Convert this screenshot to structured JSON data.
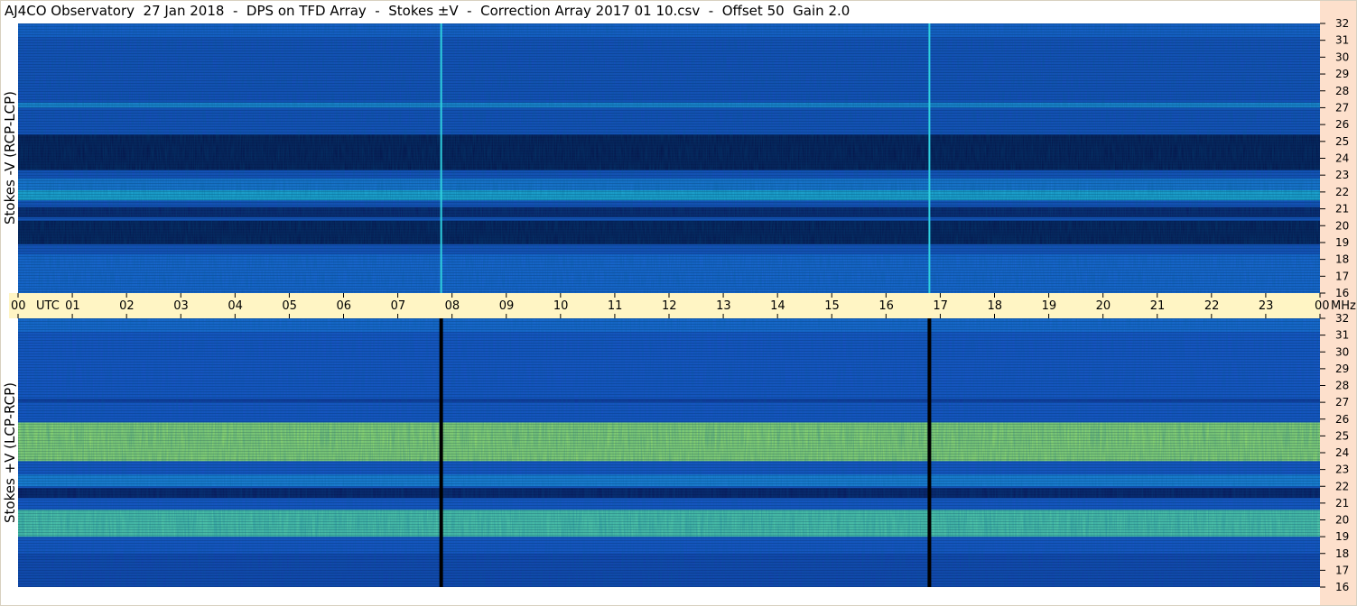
{
  "title": "AJ4CO Observatory  27 Jan 2018  -  DPS on TFD Array  -  Stokes ±V  -  Correction Array 2017 01 10.csv  -  Offset 50  Gain 2.0",
  "colors": {
    "background": "#ffffff",
    "axis_strip": "#fff5c4",
    "freq_strip": "#fde0cc",
    "dark": "#04082e",
    "blue": "#1a5fd6",
    "cyan": "#22c6d8",
    "yellow": "#e6f53a"
  },
  "chart_data": {
    "type": "heatmap",
    "xaxis": {
      "unit_label": "UTC",
      "ticks": [
        "00",
        "01",
        "02",
        "03",
        "04",
        "05",
        "06",
        "07",
        "08",
        "09",
        "10",
        "11",
        "12",
        "13",
        "14",
        "15",
        "16",
        "17",
        "18",
        "19",
        "20",
        "21",
        "22",
        "23",
        "00"
      ],
      "range": [
        0,
        24
      ]
    },
    "yaxis": {
      "unit_label": "MHz",
      "ticks": [
        16,
        17,
        18,
        19,
        20,
        21,
        22,
        23,
        24,
        25,
        26,
        27,
        28,
        29,
        30,
        31,
        32
      ],
      "range": [
        16,
        32
      ]
    },
    "panels": [
      {
        "name": "top",
        "ylabel": "Stokes -V (RCP-LCP)",
        "base_level": 0.34,
        "bands": [
          {
            "freq": [
              16.0,
              18.3
            ],
            "level": 0.42
          },
          {
            "freq": [
              18.9,
              20.3
            ],
            "level": 0.06
          },
          {
            "freq": [
              20.5,
              21.1
            ],
            "level": 0.12
          },
          {
            "freq": [
              21.5,
              22.1
            ],
            "level": 0.58
          },
          {
            "freq": [
              22.1,
              22.8
            ],
            "level": 0.46
          },
          {
            "freq": [
              23.3,
              25.4
            ],
            "level": 0.05
          },
          {
            "freq": [
              27.0,
              27.3
            ],
            "level": 0.5
          }
        ],
        "vertical_lines": [
          {
            "utc": 7.8,
            "color": "#2fd0de"
          },
          {
            "utc": 16.8,
            "color": "#2fd0de"
          }
        ]
      },
      {
        "name": "bottom",
        "ylabel": "Stokes +V (LCP-RCP)",
        "base_level": 0.36,
        "bands": [
          {
            "freq": [
              16.0,
              18.0
            ],
            "level": 0.3
          },
          {
            "freq": [
              19.0,
              20.6
            ],
            "level": 0.7
          },
          {
            "freq": [
              21.3,
              21.9
            ],
            "level": 0.1
          },
          {
            "freq": [
              22.0,
              22.7
            ],
            "level": 0.48
          },
          {
            "freq": [
              23.5,
              25.8
            ],
            "level": 0.8
          },
          {
            "freq": [
              27.0,
              27.2
            ],
            "level": 0.25
          }
        ],
        "vertical_lines": [
          {
            "utc": 7.8,
            "color": "#000000"
          },
          {
            "utc": 16.8,
            "color": "#000000"
          }
        ]
      }
    ]
  }
}
